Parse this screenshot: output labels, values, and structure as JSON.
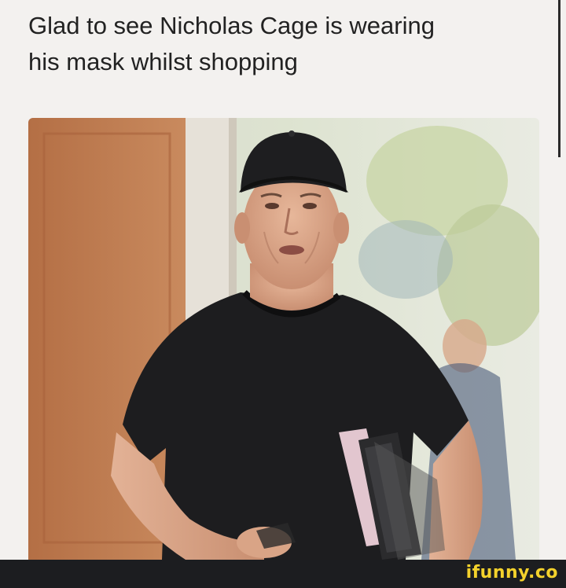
{
  "caption": {
    "line1": "Glad to see Nicholas Cage is wearing",
    "line2": "his mask whilst shopping"
  },
  "photo": {
    "subject": "man in black baseball cap and black t-shirt carrying folders"
  },
  "watermark": {
    "brand": "ifunny.co"
  }
}
